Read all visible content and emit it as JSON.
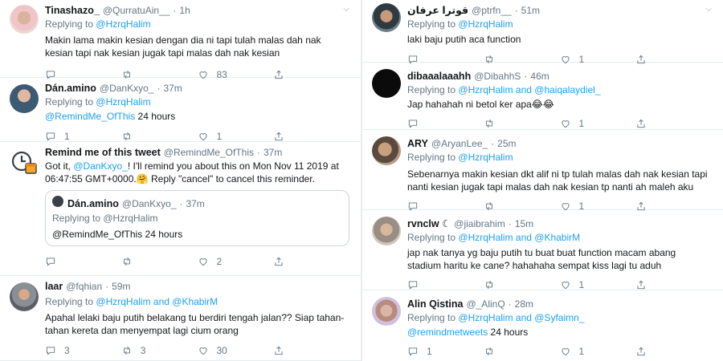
{
  "left": [
    {
      "name": "Tinashazo_",
      "handle": "@QurratuAin__",
      "time": "1h",
      "replying": "Replying to",
      "to": "@HzrqHalim",
      "text": "Makin lama makin kesian dengan dia ni tapi tulah malas dah nak kesian tapi nak kesian jugak tapi malas dah nak kesian",
      "replies": "",
      "retweets": "",
      "likes": "83"
    },
    {
      "name": "Dán.amino",
      "handle": "@DanKxyo_",
      "time": "37m",
      "replying": "Replying to",
      "to": "@HzrqHalim",
      "mention": "@RemindMe_OfThis",
      "text": " 24 hours",
      "replies": "1",
      "retweets": "",
      "likes": "1"
    },
    {
      "name": "Remind me of this tweet",
      "handle": "@RemindMe_OfThis",
      "time": "37m",
      "text_a": "Got it, ",
      "mention": "@DanKxyo_",
      "text_b": "! I'll remind you about this on Mon Nov 11 2019 at 06:47:55 GMT+0000.🤗 Reply \"cancel\" to cancel this reminder.",
      "quote": {
        "name": "Dán.amino",
        "handle": "@DanKxyo_",
        "time": "37m",
        "replying": "Replying to @HzrqHalim",
        "text": "@RemindMe_OfThis 24 hours"
      },
      "replies": "",
      "retweets": "",
      "likes": "2"
    },
    {
      "name": "laar",
      "handle": "@fqhian",
      "time": "59m",
      "replying": "Replying to",
      "to": "@HzrqHalim and @KhabirM",
      "text": "Apahal lelaki baju putih belakang tu berdiri tengah jalan?? Siap tahan-tahan kereta dan menyempat lagi cium orang",
      "replies": "3",
      "retweets": "3",
      "likes": "30"
    }
  ],
  "right": [
    {
      "name": "قوترا عرفان",
      "handle": "@ptrfn__",
      "time": "51m",
      "replying": "Replying to",
      "to": "@HzrqHalim",
      "text": "laki baju putih aca function",
      "replies": "",
      "retweets": "",
      "likes": "1"
    },
    {
      "name": "dibaaalaaahh",
      "handle": "@DibahhS",
      "time": "46m",
      "replying": "Replying to",
      "to": "@HzrqHalim and @haiqalaydiel_",
      "text": "Jap hahahah ni betol ker apa😂😂",
      "replies": "",
      "retweets": "",
      "likes": "1"
    },
    {
      "name": "ARY",
      "handle": "@AryanLee_",
      "time": "25m",
      "replying": "Replying to",
      "to": "@HzrqHalim",
      "text": "Sebenarnya makin kesian dkt alif ni tp tulah malas dah nak kesian tapi nanti kesian jugak tapi malas dah nak kesian tp nanti ah maleh aku",
      "replies": "",
      "retweets": "",
      "likes": "1"
    },
    {
      "name": "rvnclw ☾",
      "handle": "@jiaibrahim",
      "time": "15m",
      "replying": "Replying to",
      "to": "@HzrqHalim and @KhabirM",
      "text": "jap nak tanya yg baju putih tu buat buat function macam abang stadium haritu ke cane? hahahaha sempat kiss lagi tu aduh",
      "replies": "",
      "retweets": "",
      "likes": "1"
    },
    {
      "name": "Alin Qistina",
      "handle": "@_AlinQ",
      "time": "28m",
      "replying": "Replying to",
      "to": "@HzrqHalim and @Syfaimn_",
      "mention": "@remindmetweets",
      "text": " 24 hours",
      "replies": "1",
      "retweets": "",
      "likes": "1"
    }
  ],
  "colors": {
    "link": "#1da1f2",
    "muted": "#657786",
    "border": "#e6ecf0"
  },
  "icons": [
    "reply-icon",
    "retweet-icon",
    "like-icon",
    "share-icon",
    "chevron-down-icon"
  ]
}
